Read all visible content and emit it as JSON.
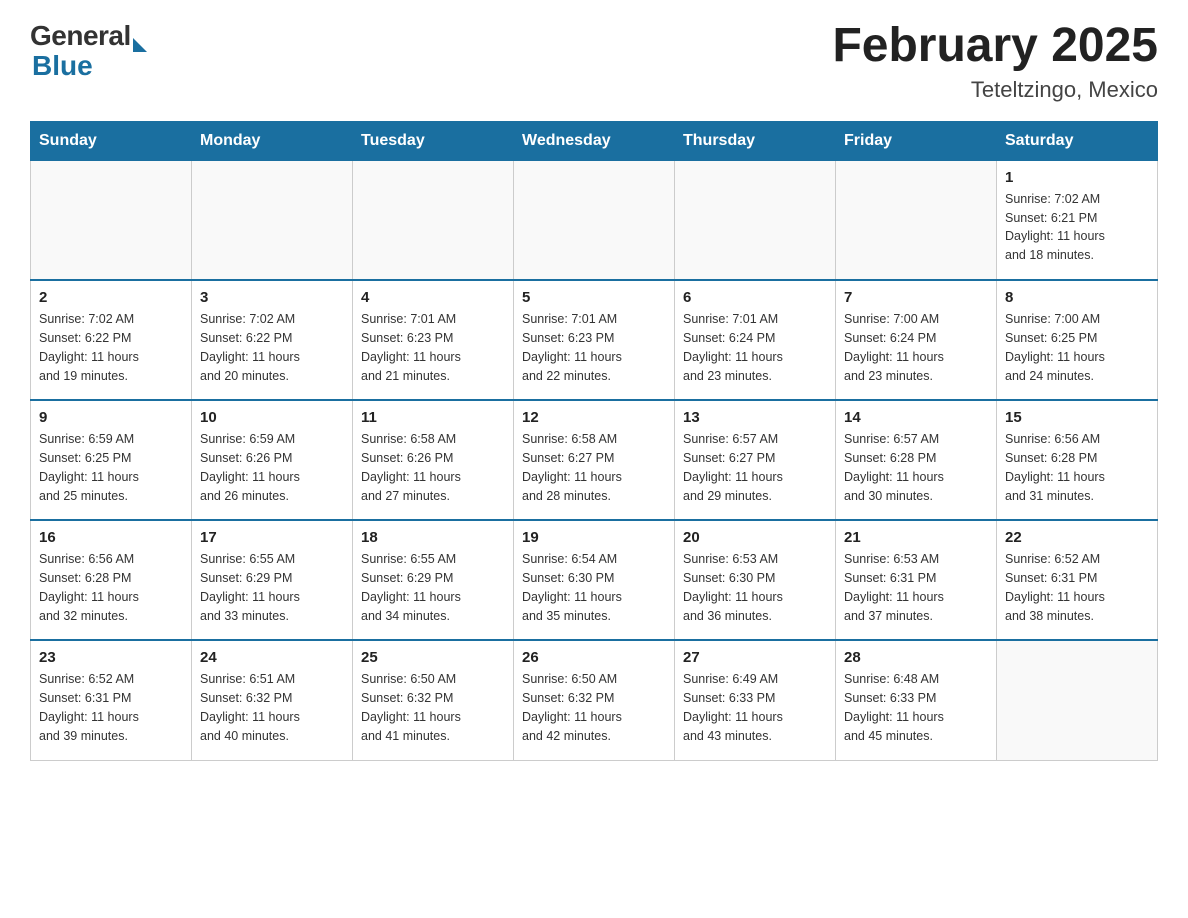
{
  "header": {
    "logo": {
      "text_general": "General",
      "text_blue": "Blue"
    },
    "title": "February 2025",
    "location": "Teteltzingo, Mexico"
  },
  "days_of_week": [
    "Sunday",
    "Monday",
    "Tuesday",
    "Wednesday",
    "Thursday",
    "Friday",
    "Saturday"
  ],
  "weeks": [
    [
      {
        "day": "",
        "info": ""
      },
      {
        "day": "",
        "info": ""
      },
      {
        "day": "",
        "info": ""
      },
      {
        "day": "",
        "info": ""
      },
      {
        "day": "",
        "info": ""
      },
      {
        "day": "",
        "info": ""
      },
      {
        "day": "1",
        "info": "Sunrise: 7:02 AM\nSunset: 6:21 PM\nDaylight: 11 hours\nand 18 minutes."
      }
    ],
    [
      {
        "day": "2",
        "info": "Sunrise: 7:02 AM\nSunset: 6:22 PM\nDaylight: 11 hours\nand 19 minutes."
      },
      {
        "day": "3",
        "info": "Sunrise: 7:02 AM\nSunset: 6:22 PM\nDaylight: 11 hours\nand 20 minutes."
      },
      {
        "day": "4",
        "info": "Sunrise: 7:01 AM\nSunset: 6:23 PM\nDaylight: 11 hours\nand 21 minutes."
      },
      {
        "day": "5",
        "info": "Sunrise: 7:01 AM\nSunset: 6:23 PM\nDaylight: 11 hours\nand 22 minutes."
      },
      {
        "day": "6",
        "info": "Sunrise: 7:01 AM\nSunset: 6:24 PM\nDaylight: 11 hours\nand 23 minutes."
      },
      {
        "day": "7",
        "info": "Sunrise: 7:00 AM\nSunset: 6:24 PM\nDaylight: 11 hours\nand 23 minutes."
      },
      {
        "day": "8",
        "info": "Sunrise: 7:00 AM\nSunset: 6:25 PM\nDaylight: 11 hours\nand 24 minutes."
      }
    ],
    [
      {
        "day": "9",
        "info": "Sunrise: 6:59 AM\nSunset: 6:25 PM\nDaylight: 11 hours\nand 25 minutes."
      },
      {
        "day": "10",
        "info": "Sunrise: 6:59 AM\nSunset: 6:26 PM\nDaylight: 11 hours\nand 26 minutes."
      },
      {
        "day": "11",
        "info": "Sunrise: 6:58 AM\nSunset: 6:26 PM\nDaylight: 11 hours\nand 27 minutes."
      },
      {
        "day": "12",
        "info": "Sunrise: 6:58 AM\nSunset: 6:27 PM\nDaylight: 11 hours\nand 28 minutes."
      },
      {
        "day": "13",
        "info": "Sunrise: 6:57 AM\nSunset: 6:27 PM\nDaylight: 11 hours\nand 29 minutes."
      },
      {
        "day": "14",
        "info": "Sunrise: 6:57 AM\nSunset: 6:28 PM\nDaylight: 11 hours\nand 30 minutes."
      },
      {
        "day": "15",
        "info": "Sunrise: 6:56 AM\nSunset: 6:28 PM\nDaylight: 11 hours\nand 31 minutes."
      }
    ],
    [
      {
        "day": "16",
        "info": "Sunrise: 6:56 AM\nSunset: 6:28 PM\nDaylight: 11 hours\nand 32 minutes."
      },
      {
        "day": "17",
        "info": "Sunrise: 6:55 AM\nSunset: 6:29 PM\nDaylight: 11 hours\nand 33 minutes."
      },
      {
        "day": "18",
        "info": "Sunrise: 6:55 AM\nSunset: 6:29 PM\nDaylight: 11 hours\nand 34 minutes."
      },
      {
        "day": "19",
        "info": "Sunrise: 6:54 AM\nSunset: 6:30 PM\nDaylight: 11 hours\nand 35 minutes."
      },
      {
        "day": "20",
        "info": "Sunrise: 6:53 AM\nSunset: 6:30 PM\nDaylight: 11 hours\nand 36 minutes."
      },
      {
        "day": "21",
        "info": "Sunrise: 6:53 AM\nSunset: 6:31 PM\nDaylight: 11 hours\nand 37 minutes."
      },
      {
        "day": "22",
        "info": "Sunrise: 6:52 AM\nSunset: 6:31 PM\nDaylight: 11 hours\nand 38 minutes."
      }
    ],
    [
      {
        "day": "23",
        "info": "Sunrise: 6:52 AM\nSunset: 6:31 PM\nDaylight: 11 hours\nand 39 minutes."
      },
      {
        "day": "24",
        "info": "Sunrise: 6:51 AM\nSunset: 6:32 PM\nDaylight: 11 hours\nand 40 minutes."
      },
      {
        "day": "25",
        "info": "Sunrise: 6:50 AM\nSunset: 6:32 PM\nDaylight: 11 hours\nand 41 minutes."
      },
      {
        "day": "26",
        "info": "Sunrise: 6:50 AM\nSunset: 6:32 PM\nDaylight: 11 hours\nand 42 minutes."
      },
      {
        "day": "27",
        "info": "Sunrise: 6:49 AM\nSunset: 6:33 PM\nDaylight: 11 hours\nand 43 minutes."
      },
      {
        "day": "28",
        "info": "Sunrise: 6:48 AM\nSunset: 6:33 PM\nDaylight: 11 hours\nand 45 minutes."
      },
      {
        "day": "",
        "info": ""
      }
    ]
  ]
}
